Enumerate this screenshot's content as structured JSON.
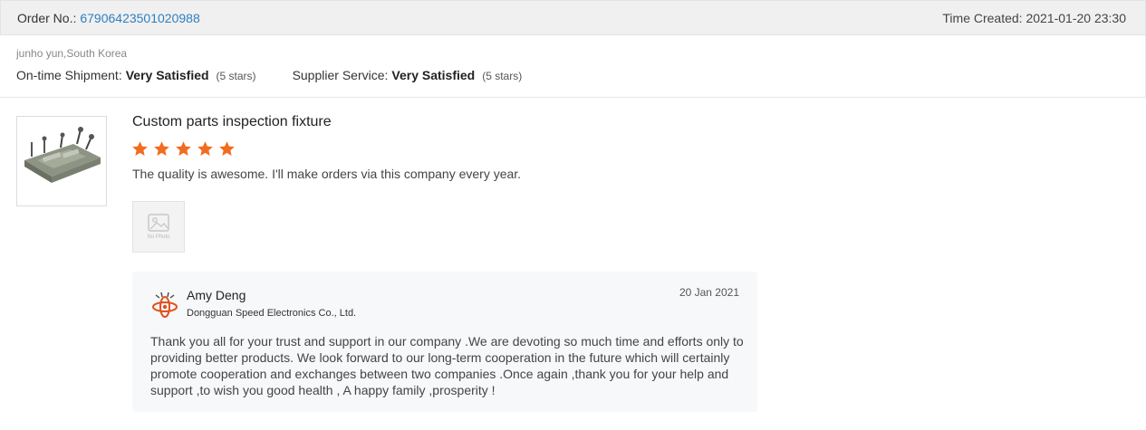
{
  "order": {
    "label": "Order No.:",
    "number": "67906423501020988",
    "time_created": "Time Created: 2021-01-20 23:30"
  },
  "buyer": {
    "name_country": "junho yun,South Korea",
    "ratings": [
      {
        "label": "On-time Shipment:",
        "value": "Very Satisfied",
        "stars": "(5 stars)"
      },
      {
        "label": "Supplier Service:",
        "value": "Very Satisfied",
        "stars": "(5 stars)"
      }
    ]
  },
  "review": {
    "product_title": "Custom parts inspection fixture",
    "star_rating": 5,
    "text": "The quality is awesome. I'll make orders via this company every year.",
    "photo_placeholder_label": "No Photo",
    "colors": {
      "star": "#f26c1f",
      "link": "#2f7fc1"
    }
  },
  "reply": {
    "name": "Amy Deng",
    "company": "Dongguan Speed Electronics Co., Ltd.",
    "date": "20 Jan 2021",
    "text": "Thank you all for your trust and support in our company .We are devoting so much time and efforts only to providing better products. We look forward to our long-term cooperation in the future which will certainly promote cooperation and exchanges between two companies .Once again ,thank you for your help and support ,to wish you good health , A happy family ,prosperity !"
  }
}
